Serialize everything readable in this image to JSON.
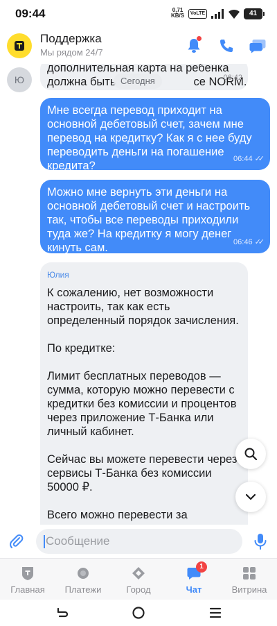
{
  "status_bar": {
    "time": "09:44",
    "net_speed_value": "0,71",
    "net_speed_unit": "KB/S",
    "volte": "VoLTE",
    "battery": "41"
  },
  "header": {
    "title": "Поддержка",
    "subtitle": "Мы рядом 24/7",
    "notification_dot": true
  },
  "chat": {
    "avatar_letter": "Ю",
    "date_label": "Сегодня",
    "messages": [
      {
        "direction": "incoming",
        "text": "дополнительная карта на ребенка должна быть в тарифе NORM.",
        "line1": "дополнительная карта на ребенка",
        "line2_a": "должна быть",
        "line2_b": "се NORM.",
        "time": "06:42"
      },
      {
        "direction": "outgoing",
        "text": "Мне всегда перевод приходит на основной дебетовый счет, зачем мне перевод на кредитку? Как я с нее буду переводить деньги на погашение кредита?",
        "time": "06:44",
        "read": true
      },
      {
        "direction": "outgoing",
        "text": "Можно мне вернуть эти деньги на основной дебетовый счет и настроить так, чтобы все переводы приходили туда же? На кредитку я могу денег кинуть сам.",
        "time": "06:46",
        "read": true
      },
      {
        "direction": "incoming",
        "sender": "Юлия",
        "paragraphs": [
          "К сожалению, нет возможности настроить, так как есть определенный порядок зачисления.",
          "По кредитке:",
          "Лимит бесплатных переводов — сумма, которую можно перевести с кредитки без комиссии и процентов через приложение Т-Банка или личный кабинет.",
          "Сейчас вы можете перевести через сервисы Т-Банка без комиссии 50000 ₽.",
          "Всего можно перевести за"
        ]
      }
    ]
  },
  "composer": {
    "placeholder": "Сообщение"
  },
  "tabbar": {
    "tabs": [
      {
        "label": "Главная",
        "icon": "home-icon"
      },
      {
        "label": "Платежи",
        "icon": "payments-icon"
      },
      {
        "label": "Город",
        "icon": "city-icon"
      },
      {
        "label": "Чат",
        "icon": "chat-icon",
        "active": true,
        "badge": "1"
      },
      {
        "label": "Витрина",
        "icon": "showcase-icon"
      }
    ]
  },
  "colors": {
    "accent": "#428bf9",
    "outgoing_bubble": "#428bf9",
    "incoming_bubble": "#eef0f3",
    "brand_yellow": "#ffdd2d",
    "badge_red": "#f24343"
  }
}
